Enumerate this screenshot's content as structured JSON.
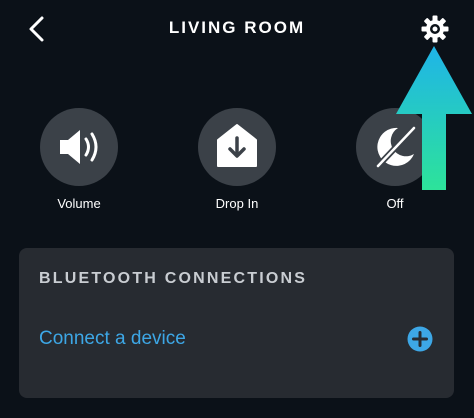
{
  "header": {
    "title": "LIVING ROOM",
    "back_icon": "chevron-left-icon",
    "settings_icon": "gear-icon"
  },
  "actions": [
    {
      "label": "Volume",
      "icon": "speaker-icon"
    },
    {
      "label": "Drop In",
      "icon": "drop-in-icon"
    },
    {
      "label": "Off",
      "icon": "do-not-disturb-off-icon"
    }
  ],
  "bluetooth": {
    "heading": "BLUETOOTH CONNECTIONS",
    "connect_label": "Connect a device",
    "add_icon": "plus-circle-icon"
  },
  "colors": {
    "background": "#0b1118",
    "card": "#272b31",
    "action_circle": "#3b4148",
    "link": "#3da7e6",
    "arrow_gradient": [
      "#1fb4e8",
      "#2de39a"
    ]
  }
}
